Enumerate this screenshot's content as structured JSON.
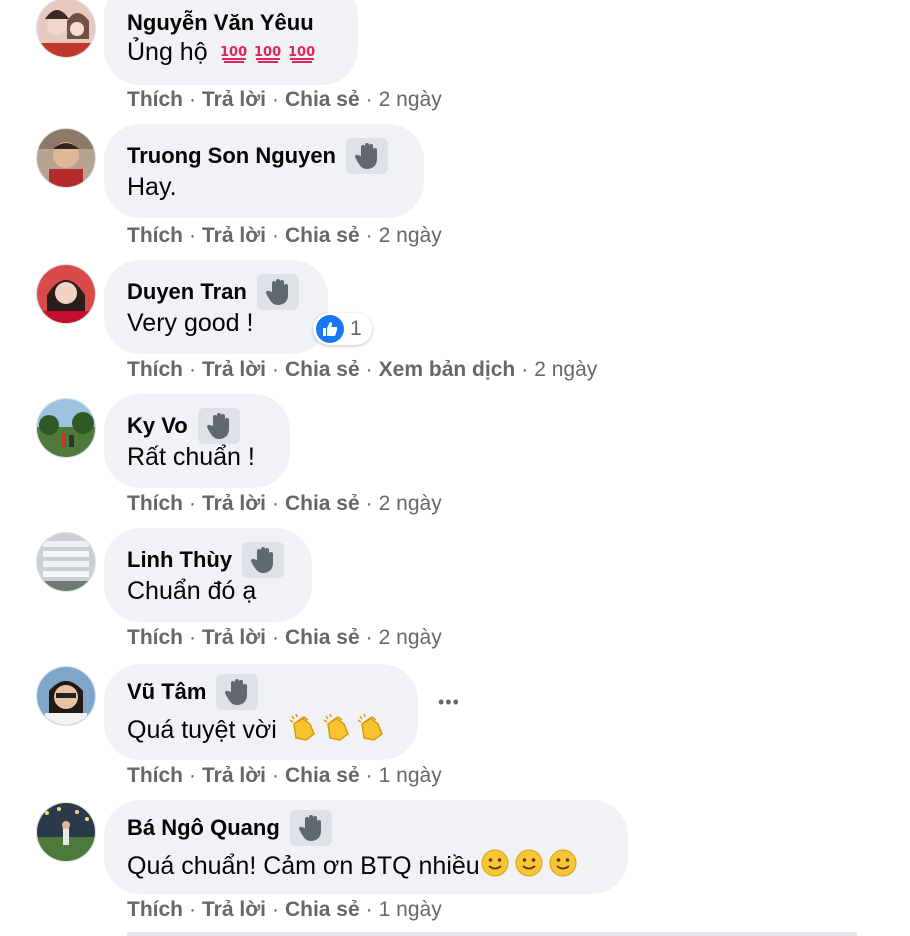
{
  "colors": {
    "bubble": "#f0f2f5",
    "meta": "#65676b",
    "like_blue": "#1877f2"
  },
  "comments": [
    {
      "name": "Nguyễn Văn Yêuu",
      "text": "Ủng hộ",
      "emoji": "hundred-points",
      "emoji_count": 3,
      "badge": false,
      "actions": {
        "like": "Thích",
        "reply": "Trả lời",
        "share": "Chia sẻ",
        "time": "2 ngày"
      }
    },
    {
      "name": "Truong Son Nguyen",
      "text": "Hay.",
      "badge": true,
      "actions": {
        "like": "Thích",
        "reply": "Trả lời",
        "share": "Chia sẻ",
        "time": "2 ngày"
      }
    },
    {
      "name": "Duyen Tran",
      "text": "Very good !",
      "badge": true,
      "reaction_count": "1",
      "actions": {
        "like": "Thích",
        "reply": "Trả lời",
        "share": "Chia sẻ",
        "translate": "Xem bản dịch",
        "time": "2 ngày"
      }
    },
    {
      "name": "Ky Vo",
      "text": "Rất chuẩn !",
      "badge": true,
      "actions": {
        "like": "Thích",
        "reply": "Trả lời",
        "share": "Chia sẻ",
        "time": "2 ngày"
      }
    },
    {
      "name": "Linh Thùy",
      "text": "Chuẩn đó ạ",
      "badge": true,
      "actions": {
        "like": "Thích",
        "reply": "Trả lời",
        "share": "Chia sẻ",
        "time": "2 ngày"
      }
    },
    {
      "name": "Vũ Tâm",
      "text": "Quá tuyệt vời",
      "emoji": "clapping-hands",
      "emoji_count": 3,
      "badge": true,
      "more": "•••",
      "actions": {
        "like": "Thích",
        "reply": "Trả lời",
        "share": "Chia sẻ",
        "time": "1 ngày"
      }
    },
    {
      "name": "Bá Ngô Quang",
      "text": "Quá chuẩn! Cảm ơn BTQ nhiều",
      "emoji": "smiling-face",
      "emoji_count": 3,
      "badge": true,
      "actions": {
        "like": "Thích",
        "reply": "Trả lời",
        "share": "Chia sẻ",
        "time": "1 ngày"
      }
    }
  ]
}
